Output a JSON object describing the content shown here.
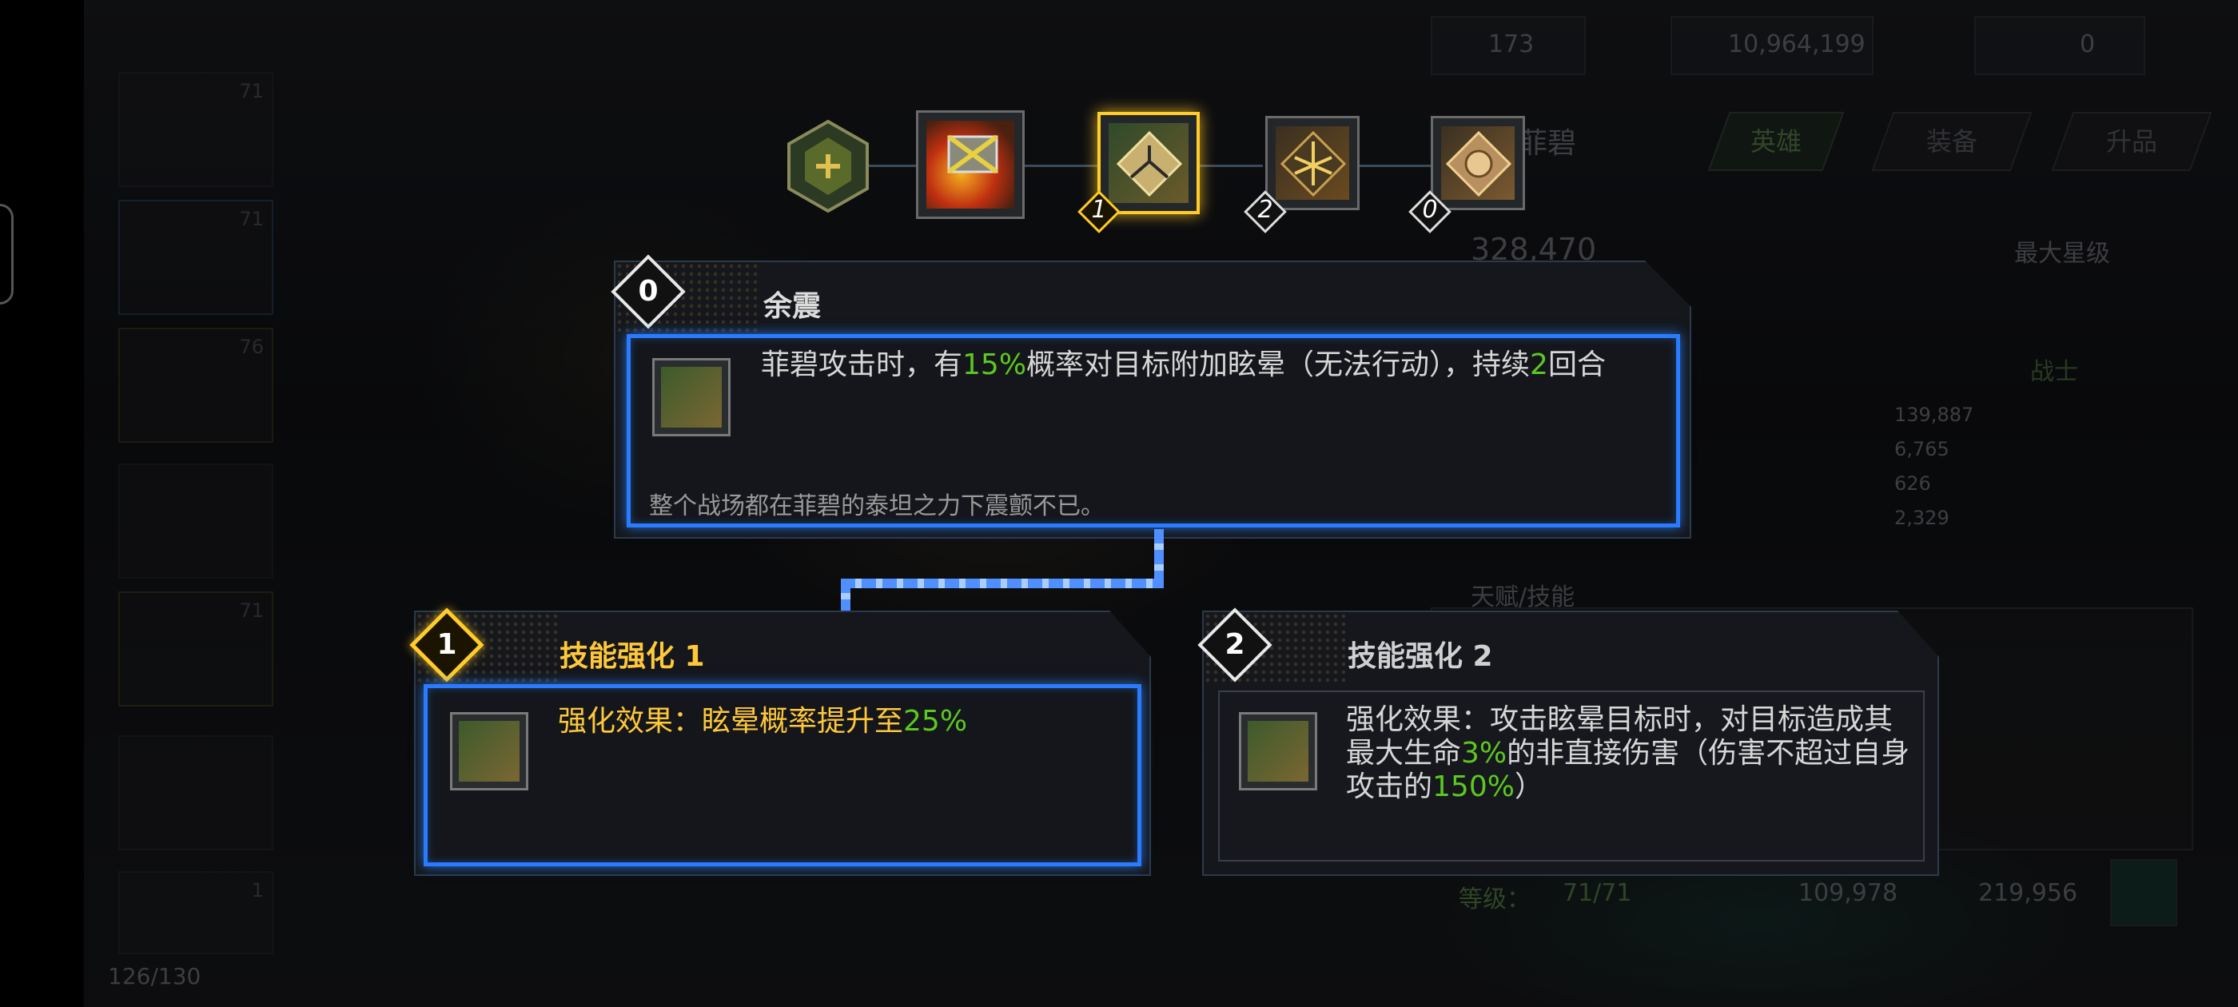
{
  "background": {
    "stat_173": "173",
    "coins": "10,964,199",
    "gems": "0",
    "hero_name": "菲碧",
    "power": "328,470",
    "tabs": [
      "英雄",
      "装备",
      "升品"
    ],
    "max_star": "最大星级",
    "class": "战士",
    "stats": [
      "139,887",
      "6,765",
      "626",
      "2,329"
    ],
    "talent_label": "天赋/技能",
    "level_label": "等级：",
    "level": "71/71",
    "cost_a": "109,978",
    "cost_b": "219,956",
    "roster_count": "126/130",
    "card_levels": [
      "71",
      "71",
      "76",
      "71",
      "1"
    ]
  },
  "skill_chain": {
    "badges": [
      "1",
      "2",
      "0"
    ]
  },
  "main_skill": {
    "badge": "0",
    "name": "余震",
    "desc_a": "菲碧攻击时，有",
    "desc_pct": "15%",
    "desc_b": "概率对目标附加眩晕（无法行动），持续",
    "desc_turns": "2",
    "desc_c": "回合",
    "flavor": "整个战场都在菲碧的泰坦之力下震颤不已。"
  },
  "enhance_1": {
    "badge": "1",
    "title": "技能强化 1",
    "desc_a": "强化效果：眩晕概率提升至",
    "desc_pct": "25%"
  },
  "enhance_2": {
    "badge": "2",
    "title": "技能强化 2",
    "desc_a": "强化效果：攻击眩晕目标时，对目标造成其最大生命",
    "desc_pct": "3%",
    "desc_b": "的非直接伤害（伤害不超过自身攻击的",
    "desc_pct2": "150%",
    "desc_c": "）"
  },
  "colors": {
    "accent_blue": "#2a7bff",
    "highlight_green": "#5bc81f",
    "highlight_gold": "#ffc83a"
  }
}
